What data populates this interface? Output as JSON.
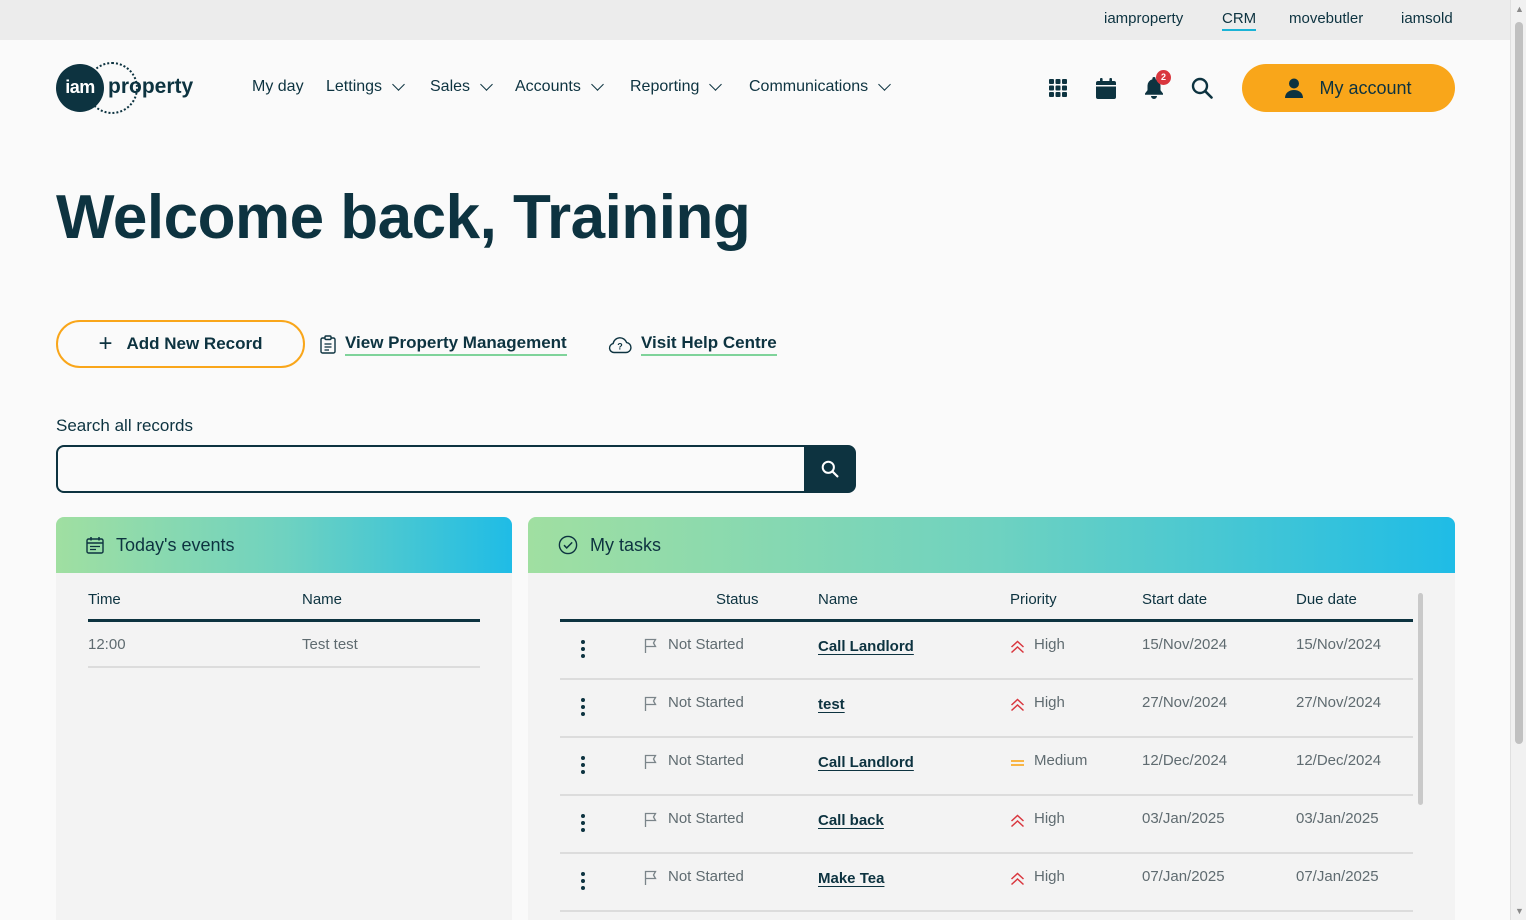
{
  "utility_nav": [
    "iamproperty",
    "CRM",
    "movebutler",
    "iamsold"
  ],
  "brand": {
    "logo_mark": "iam",
    "logo_word": "property",
    "accent": "#f9a61a",
    "navy": "#0d3340"
  },
  "main_nav": [
    "My day",
    "Lettings",
    "Sales",
    "Accounts",
    "Reporting",
    "Communications"
  ],
  "header": {
    "notification_count": "2",
    "account_label": "My account"
  },
  "welcome_heading": "Welcome back, Training",
  "actions": {
    "add_record": "Add New Record",
    "property_management": "View Property Management",
    "help_centre": "Visit Help Centre"
  },
  "search": {
    "label": "Search all records",
    "value": "",
    "placeholder": ""
  },
  "events": {
    "title": "Today's events",
    "columns": [
      "Time",
      "Name"
    ],
    "rows": [
      {
        "time": "12:00",
        "name": "Test test"
      }
    ]
  },
  "tasks": {
    "title": "My tasks",
    "columns": [
      "Status",
      "Name",
      "Priority",
      "Start date",
      "Due date"
    ],
    "rows": [
      {
        "status": "Not Started",
        "name": "Call Landlord",
        "priority": "High",
        "start": "15/Nov/2024",
        "due": "15/Nov/2024"
      },
      {
        "status": "Not Started",
        "name": "test",
        "priority": "High",
        "start": "27/Nov/2024",
        "due": "27/Nov/2024"
      },
      {
        "status": "Not Started",
        "name": "Call Landlord",
        "priority": "Medium",
        "start": "12/Dec/2024",
        "due": "12/Dec/2024"
      },
      {
        "status": "Not Started",
        "name": "Call back",
        "priority": "High",
        "start": "03/Jan/2025",
        "due": "03/Jan/2025"
      },
      {
        "status": "Not Started",
        "name": "Make Tea",
        "priority": "High",
        "start": "07/Jan/2025",
        "due": "07/Jan/2025"
      }
    ]
  }
}
